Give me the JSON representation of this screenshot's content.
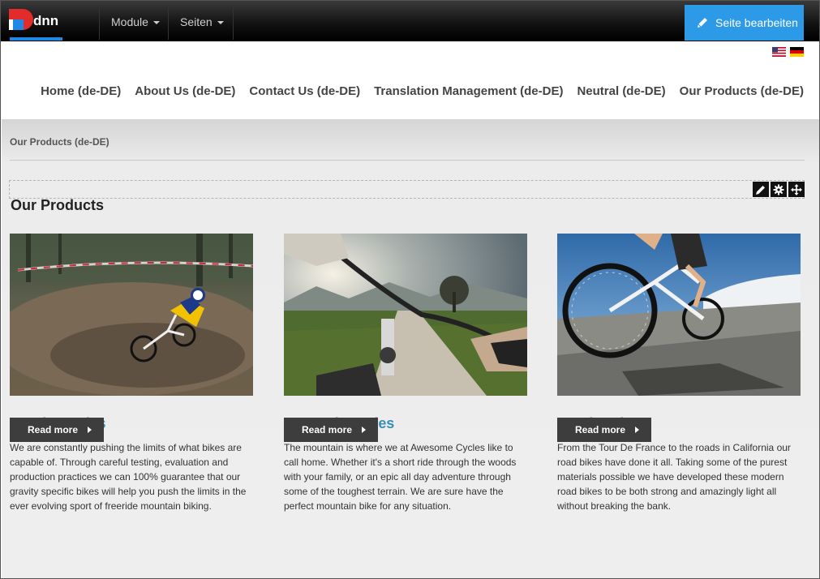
{
  "controlbar": {
    "logo_text": "DNN",
    "menus": [
      {
        "label": "Module"
      },
      {
        "label": "Seiten"
      }
    ],
    "edit_button_label": "Seite bearbeiten"
  },
  "header": {
    "languages": [
      {
        "name": "en-US",
        "icon": "us-flag-icon"
      },
      {
        "name": "de-DE",
        "icon": "german-flag-icon"
      }
    ],
    "nav": [
      {
        "label": "Home (de-DE)"
      },
      {
        "label": "About Us (de-DE)"
      },
      {
        "label": "Contact Us (de-DE)"
      },
      {
        "label": "Translation Management (de-DE)"
      },
      {
        "label": "Neutral (de-DE)"
      },
      {
        "label": "Our Products (de-DE)"
      }
    ]
  },
  "breadcrumb": "Our Products (de-DE)",
  "module": {
    "title": "Our Products",
    "action_icons": [
      "pencil-icon",
      "gear-icon",
      "move-icon"
    ]
  },
  "products": [
    {
      "title": "Gravity Series",
      "description": "We are constantly pushing the limits of what bikes are capable of. Through careful testing, evaluation and production practices we can 100% guarantee that our gravity specific bikes will help you push the limits in the ever evolving sport of freeride mountain biking.",
      "button": "Read more",
      "image": "gravity-bike-photo"
    },
    {
      "title": "Mountain Series",
      "description": "The mountain is where we at Awesome Cycles like to call home. Whether it's a short ride through the woods with your family, or an epic all day adventure through some of the toughest terrain. We are sure have the perfect mountain bike for any situation.",
      "button": "Read more",
      "image": "mountain-bike-photo"
    },
    {
      "title": "Road Series",
      "description": "From the Tour De France to the roads in California our road bikes have done it all. Taking some of the purest materials possible we have developed these modern road bikes to be both strong and amazingly light all without breaking the bank.",
      "button": "Read more",
      "image": "road-bike-photo"
    }
  ],
  "colors": {
    "accent": "#2d9ae8",
    "product_title": "#3a8fb7",
    "button": "#3d3d3d"
  }
}
